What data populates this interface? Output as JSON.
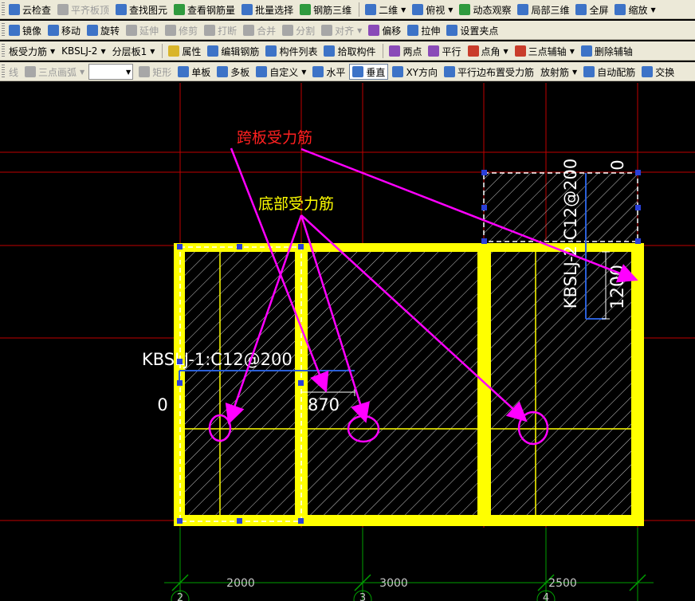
{
  "toolbars": {
    "row1": [
      {
        "label": "云检查",
        "icon": "cloud-check-icon",
        "color": "blue"
      },
      {
        "label": "平齐板顶",
        "icon": "flush-top-icon",
        "color": "gray",
        "disabled": true
      },
      {
        "label": "查找图元",
        "icon": "find-icon",
        "color": "blue"
      },
      {
        "label": "查看钢筋量",
        "icon": "rebar-quantity-icon",
        "color": "green"
      },
      {
        "label": "批量选择",
        "icon": "batch-select-icon",
        "color": "blue"
      },
      {
        "label": "钢筋三维",
        "icon": "rebar-3d-icon",
        "color": "green"
      },
      {
        "label": "二维",
        "icon": "2d-icon",
        "color": "blue",
        "dropdown": true
      },
      {
        "label": "俯视",
        "icon": "top-view-icon",
        "color": "blue",
        "dropdown": true
      },
      {
        "label": "动态观察",
        "icon": "orbit-icon",
        "color": "green"
      },
      {
        "label": "局部三维",
        "icon": "local-3d-icon",
        "color": "blue"
      },
      {
        "label": "全屏",
        "icon": "fullscreen-icon",
        "color": "blue"
      },
      {
        "label": "缩放",
        "icon": "zoom-icon",
        "color": "blue",
        "dropdown": true
      }
    ],
    "row2": [
      {
        "label": "镜像",
        "icon": "mirror-icon",
        "color": "blue"
      },
      {
        "label": "移动",
        "icon": "move-icon",
        "color": "blue"
      },
      {
        "label": "旋转",
        "icon": "rotate-icon",
        "color": "blue"
      },
      {
        "label": "延伸",
        "icon": "extend-icon",
        "color": "gray",
        "disabled": true
      },
      {
        "label": "修剪",
        "icon": "trim-icon",
        "color": "gray",
        "disabled": true
      },
      {
        "label": "打断",
        "icon": "break-icon",
        "color": "gray",
        "disabled": true
      },
      {
        "label": "合并",
        "icon": "merge-icon",
        "color": "gray",
        "disabled": true
      },
      {
        "label": "分割",
        "icon": "split-icon",
        "color": "gray",
        "disabled": true
      },
      {
        "label": "对齐",
        "icon": "align-icon",
        "color": "gray",
        "disabled": true,
        "dropdown": true
      },
      {
        "label": "偏移",
        "icon": "offset-icon",
        "color": "purple"
      },
      {
        "label": "拉伸",
        "icon": "stretch-icon",
        "color": "blue"
      },
      {
        "label": "设置夹点",
        "icon": "grip-point-icon",
        "color": "blue"
      }
    ],
    "row3": {
      "type_select": "板受力筋",
      "name_select": "KBSLJ-2",
      "layer_select": "分层板1",
      "buttons": [
        {
          "label": "属性",
          "icon": "properties-icon",
          "color": "yellow"
        },
        {
          "label": "编辑钢筋",
          "icon": "edit-rebar-icon",
          "color": "blue"
        },
        {
          "label": "构件列表",
          "icon": "component-list-icon",
          "color": "blue"
        },
        {
          "label": "拾取构件",
          "icon": "pick-component-icon",
          "color": "blue"
        },
        {
          "label": "两点",
          "icon": "two-point-icon",
          "color": "purple"
        },
        {
          "label": "平行",
          "icon": "parallel-icon",
          "color": "purple"
        },
        {
          "label": "点角",
          "icon": "point-angle-icon",
          "color": "red",
          "dropdown": true
        },
        {
          "label": "三点辅轴",
          "icon": "three-point-axis-icon",
          "color": "red",
          "dropdown": true
        },
        {
          "label": "删除辅轴",
          "icon": "delete-axis-icon",
          "color": "blue"
        }
      ]
    },
    "row4": [
      {
        "label": "线",
        "icon": "",
        "color": "",
        "disabled": true,
        "plain": true
      },
      {
        "label": "三点画弧",
        "icon": "arc-icon",
        "color": "gray",
        "disabled": true,
        "dropdown": true
      },
      {
        "label": "",
        "icon": "",
        "combo": true
      },
      {
        "label": "矩形",
        "icon": "rectangle-icon",
        "color": "gray",
        "disabled": true
      },
      {
        "label": "单板",
        "icon": "single-slab-icon",
        "color": "blue"
      },
      {
        "label": "多板",
        "icon": "multi-slab-icon",
        "color": "blue"
      },
      {
        "label": "自定义",
        "icon": "custom-icon",
        "color": "blue",
        "dropdown": true
      },
      {
        "label": "水平",
        "icon": "horizontal-icon",
        "color": "blue"
      },
      {
        "label": "垂直",
        "icon": "vertical-icon",
        "color": "blue",
        "pressed": true
      },
      {
        "label": "XY方向",
        "icon": "xy-direction-icon",
        "color": "blue"
      },
      {
        "label": "平行边布置受力筋",
        "icon": "parallel-edge-icon",
        "color": "blue"
      },
      {
        "label": "放射筋",
        "icon": "radial-rebar-icon",
        "color": "",
        "dropdown": true,
        "plain": true
      },
      {
        "label": "自动配筋",
        "icon": "auto-rebar-icon",
        "color": "blue"
      },
      {
        "label": "交换",
        "icon": "swap-icon",
        "color": "blue"
      }
    ]
  },
  "drawing": {
    "annotation_span": "跨板受力筋",
    "annotation_bottom": "底部受力筋",
    "label_kbslj1": "KBSLJ-1:C12@200",
    "label_kbslj2": "KBSLJ-2 C12@200",
    "dim_0_left": "0",
    "dim_0_top": "0",
    "dim_870": "870",
    "dim_1200": "1200",
    "axis_dims": [
      "2000",
      "3000",
      "2500"
    ],
    "axis_nums": [
      "2",
      "3",
      "4"
    ]
  },
  "colors": {
    "background": "#000000",
    "slab_border": "#ffff00",
    "grid_line": "#c00000",
    "grid_line_green": "#00a000",
    "annotation": "#ff00ff",
    "hatch": "#c8c8c8",
    "rebar_blue": "#2a5fd8"
  }
}
